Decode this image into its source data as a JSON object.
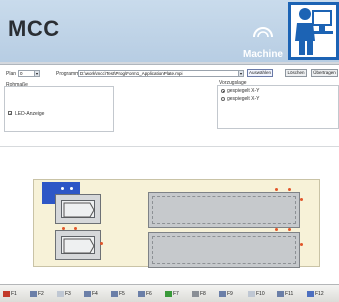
{
  "header": {
    "title": "MCC",
    "logo_text": "Machine",
    "brand_color": "#1c63b4"
  },
  "form": {
    "plan_label": "Plan",
    "plan_value": "0",
    "program_label": "Programm",
    "program_value": "D:\\work\\mcc\\Test\\Prog\\Form1_ApplicationPlate.mpi",
    "browse_button": "Auswählen",
    "load_button": "Löschen",
    "transfer_button": "Übertragen",
    "left_group_label": "Rohmaße",
    "right_group_label": "Vorzugslage",
    "radio_1": "gespiegelt X-Y",
    "radio_2": "gespiegelt X-Y",
    "led_checkbox_label": "LED-Anzeige",
    "led_checked": true
  },
  "taskbar": {
    "keys": [
      "F1",
      "F2",
      "F3",
      "F4",
      "F5",
      "F6",
      "F7",
      "F8",
      "F9",
      "F10",
      "F11",
      "F12"
    ]
  }
}
